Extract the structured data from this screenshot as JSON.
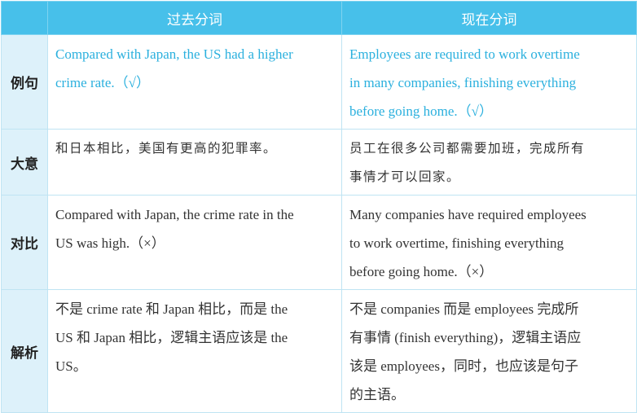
{
  "header": {
    "past": "过去分词",
    "present": "现在分词"
  },
  "rows": [
    {
      "label": "例句",
      "past": [
        "Compared with Japan, the US had a higher",
        "crime rate.（√）"
      ],
      "present": [
        "Employees are required to work overtime",
        "in many companies, finishing everything",
        "before going home.（√）"
      ]
    },
    {
      "label": "大意",
      "past": [
        "和日本相比，美国有更高的犯罪率。"
      ],
      "present": [
        "员工在很多公司都需要加班，完成所有",
        "事情才可以回家。"
      ]
    },
    {
      "label": "对比",
      "past": [
        "Compared with Japan, the crime rate in the",
        "US was high.（×）"
      ],
      "present": [
        "Many companies have required employees",
        "to work overtime, finishing everything",
        "before going home.（×）"
      ]
    },
    {
      "label": "解析",
      "past": [
        "不是 crime rate 和 Japan 相比，而是 the",
        "US 和 Japan 相比，逻辑主语应该是 the",
        "US。"
      ],
      "present": [
        "不是 companies 而是 employees 完成所",
        "有事情 (finish everything)，逻辑主语应",
        "该是 employees，同时，也应该是句子",
        "的主语。"
      ]
    }
  ],
  "colors": {
    "header_bg": "#47c0ea",
    "rowhead_bg": "#ddf1fa",
    "example_text": "#2bb0de",
    "border": "#bfe4f3"
  }
}
